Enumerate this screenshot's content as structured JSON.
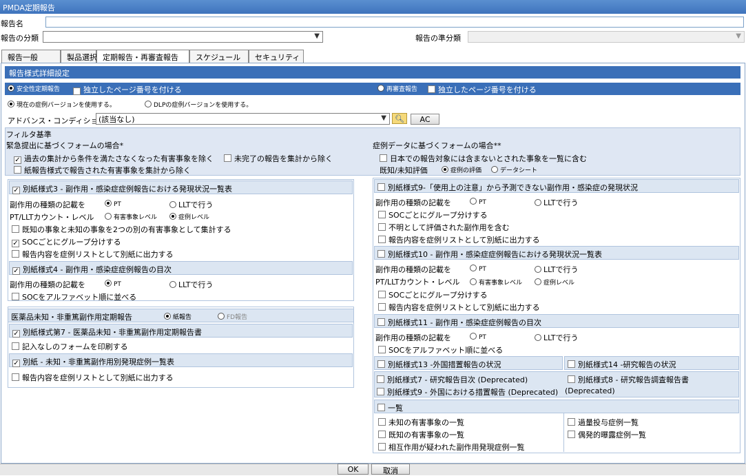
{
  "window": {
    "title": "PMDA定期報告"
  },
  "header": {
    "report_name_label": "報告名",
    "report_name_value": "",
    "category_label": "報告の分類",
    "category_value": "",
    "subcategory_label": "報告の準分類",
    "subcategory_value": ""
  },
  "tabs": [
    "報告一般",
    "製品選択",
    "定期報告・再審査報告",
    "スケジュール",
    "セキュリティ"
  ],
  "panel": {
    "title": "報告様式詳細設定"
  },
  "safety_band": {
    "safety_radio": "安全性定期報告",
    "safety_check": "独立したページ番号を付ける",
    "reexam_radio": "再審査報告",
    "reexam_check": "独立したページ番号を付ける"
  },
  "version": {
    "current": "現在の症例バージョンを使用する。",
    "dlp": "DLPの症例バージョンを使用する。"
  },
  "advanced": {
    "label": "アドバンス・コンディション",
    "value": "(該当なし)",
    "ac_button": "AC"
  },
  "filter": {
    "title": "フィルタ基準",
    "urgent_title": "緊急提出に基づくフォームの場合*",
    "urgent_opt1": "過去の集計から条件を満たさなくなった有害事象を除く",
    "urgent_opt2": "未完了の報告を集計から除く",
    "urgent_opt3": "紙報告様式で報告された有害事象を集計から除く",
    "case_title": "症例データに基づくフォームの場合**",
    "case_opt1": "日本での報告対象には含まないとされた事象を一覧に含む",
    "known_label": "既知/未知評価",
    "known_opt1": "症例の評価",
    "known_opt2": "データシート"
  },
  "left": {
    "f3_title": "別紙様式3 - 副作用・感染症症例報告における発現状況一覧表",
    "f3_type_label": "副作用の種類の記載を",
    "f3_pt": "PT",
    "f3_llt": "LLTで行う",
    "f3_count_label": "PT/LLTカウント・レベル",
    "f3_event_level": "有害事象レベル",
    "f3_case_level": "症例レベル",
    "f3_opt1": "既知の事象と未知の事象を2つの別の有害事象として集計する",
    "f3_opt2": "SOCごとにグループ分けする",
    "f3_opt3": "報告内容を症例リストとして別紙に出力する",
    "f4_title": "別紙様式4 - 副作用・感染症症例報告の目次",
    "f4_type_label": "副作用の種類の記載を",
    "f4_pt": "PT",
    "f4_llt": "LLTで行う",
    "f4_opt1": "SOCをアルファベット順に並べる",
    "drug_title": "医薬品未知・非重篤副作用定期報告",
    "drug_paper": "紙報告",
    "drug_fd": "FD報告",
    "f7_title": "別紙様式第7 - 医薬品未知・非重篤副作用定期報告書",
    "f7_opt1": "記入なしのフォームを印刷する",
    "att_title": "別紙 - 未知・非重篤副作用別発現症例一覧表",
    "att_opt1": "報告内容を症例リストとして別紙に出力する"
  },
  "right": {
    "f9_title": "別紙様式9-「使用上の注意」から予測できない副作用・感染症の発現状況",
    "f9_type_label": "副作用の種類の記載を",
    "f9_pt": "PT",
    "f9_llt": "LLTで行う",
    "f9_opt1": "SOCごとにグループ分けする",
    "f9_opt2": "不明として評価された副作用を含む",
    "f9_opt3": "報告内容を症例リストとして別紙に出力する",
    "f10_title": "別紙様式10 - 副作用・感染症症例報告における発現状況一覧表",
    "f10_type_label": "副作用の種類の記載を",
    "f10_pt": "PT",
    "f10_llt": "LLTで行う",
    "f10_count_label": "PT/LLTカウント・レベル",
    "f10_event_level": "有害事象レベル",
    "f10_case_level": "症例レベル",
    "f10_opt1": "SOCごとにグループ分けする",
    "f10_opt2": "報告内容を症例リストとして別紙に出力する",
    "f11_title": "別紙様式11 - 副作用・感染症症例報告の目次",
    "f11_type_label": "副作用の種類の記載を",
    "f11_pt": "PT",
    "f11_llt": "LLTで行う",
    "f11_opt1": "SOCをアルファベット順に並べる",
    "f13_title": "別紙様式13 -外国措置報告の状況",
    "f14_title": "別紙様式14 -研究報告の状況",
    "f7r_title": "別紙様式7 - 研究報告目次 (Deprecated)",
    "f9r_title": "別紙様式9 - 外国における措置報告 (Deprecated)",
    "f8_title": "別紙様式8 - 研究報告調査報告書",
    "f8_note": "(Deprecated)",
    "list_title": "一覧",
    "list_opt1": "未知の有害事象の一覧",
    "list_opt2": "既知の有害事象の一覧",
    "list_opt3": "相互作用が疑われた副作用発現症例一覧",
    "list_opt4": "過量投与症例一覧",
    "list_opt5": "偶発的曝露症例一覧"
  },
  "footer": {
    "ok": "OK",
    "cancel": "取消"
  }
}
